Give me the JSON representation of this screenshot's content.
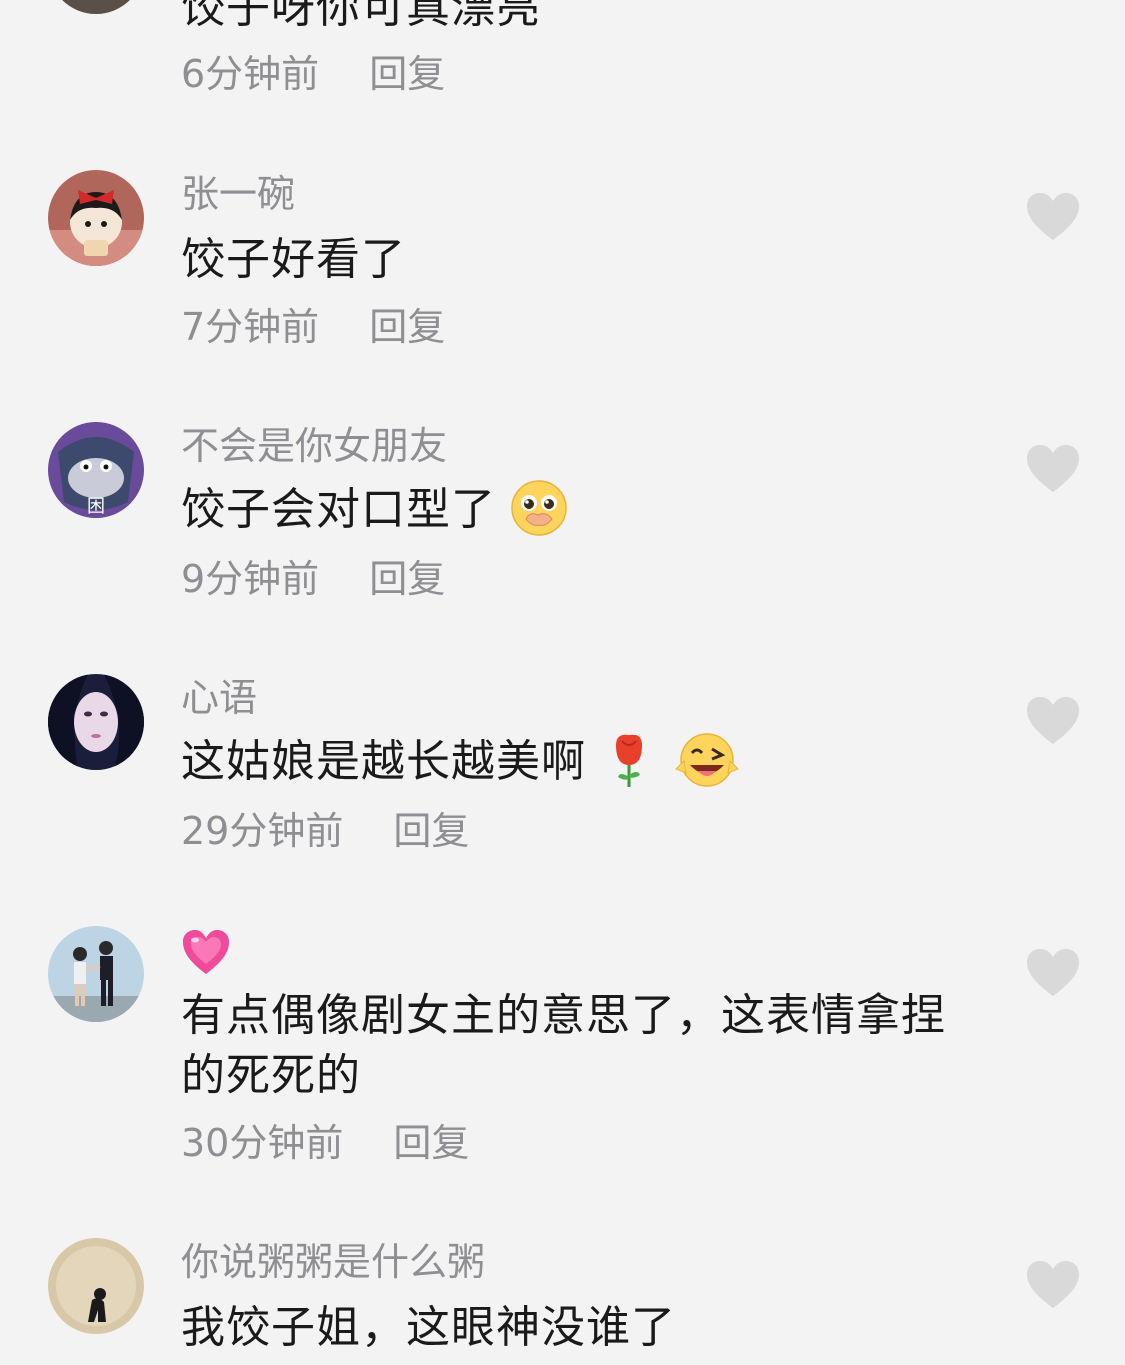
{
  "comments": [
    {
      "username": "",
      "text": "饺子呀你可真漂亮",
      "time": "6分钟前",
      "reply": "回复"
    },
    {
      "username": "张一碗",
      "text": "饺子好看了",
      "time": "7分钟前",
      "reply": "回复"
    },
    {
      "username": "不会是你女朋友",
      "text": "饺子会对口型了",
      "time": "9分钟前",
      "reply": "回复",
      "avatar_badge": "困",
      "emoji": "pleading-face-icon"
    },
    {
      "username": "心语",
      "text": "这姑娘是越长越美啊",
      "time": "29分钟前",
      "reply": "回复",
      "emoji": [
        "rose-icon",
        "winking-tongue-face-icon"
      ]
    },
    {
      "username_icon": "growing-heart-icon",
      "text_line1": "有点偶像剧女主的意思了，这表情拿捏",
      "text_line2": "的死死的",
      "time": "30分钟前",
      "reply": "回复"
    },
    {
      "username": "你说粥粥是什么粥",
      "text": "我饺子姐，这眼神没谁了"
    }
  ],
  "colors": {
    "background": "#f3f3f3",
    "username": "#8e8e93",
    "text": "#1a1a1a",
    "like_heart": "#d9d9d9"
  },
  "icons": {
    "like": "heart-icon"
  }
}
